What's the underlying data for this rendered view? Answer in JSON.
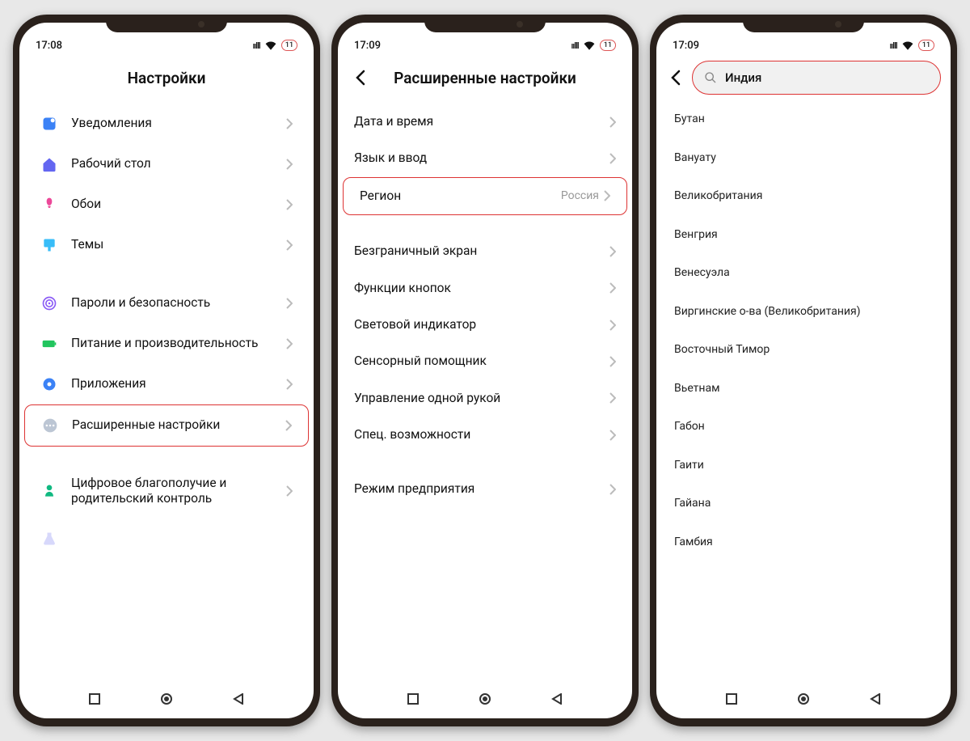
{
  "highlight_color": "#d33",
  "phone1": {
    "time": "17:08",
    "battery": "11",
    "title": "Настройки",
    "groups": [
      [
        {
          "icon": "notifications",
          "color": "#3b82f6",
          "label": "Уведомления"
        },
        {
          "icon": "home",
          "color": "#6366f1",
          "label": "Рабочий стол"
        },
        {
          "icon": "wallpaper",
          "color": "#ec4899",
          "label": "Обои"
        },
        {
          "icon": "themes",
          "color": "#38bdf8",
          "label": "Темы"
        }
      ],
      [
        {
          "icon": "security",
          "color": "#8b5cf6",
          "label": "Пароли и безопасность"
        },
        {
          "icon": "battery",
          "color": "#22c55e",
          "label": "Питание и производительность"
        },
        {
          "icon": "apps",
          "color": "#3b82f6",
          "label": "Приложения"
        },
        {
          "icon": "advanced",
          "color": "#94a3b8",
          "label": "Расширенные настройки",
          "highlight": true
        }
      ],
      [
        {
          "icon": "wellbeing",
          "color": "#10b981",
          "label": "Цифровое благополучие и родительский контроль"
        }
      ]
    ]
  },
  "phone2": {
    "time": "17:09",
    "battery": "11",
    "title": "Расширенные настройки",
    "groups": [
      [
        {
          "label": "Дата и время"
        },
        {
          "label": "Язык и ввод"
        },
        {
          "label": "Регион",
          "value": "Россия",
          "highlight": true
        }
      ],
      [
        {
          "label": "Безграничный экран"
        },
        {
          "label": "Функции кнопок"
        },
        {
          "label": "Световой индикатор"
        },
        {
          "label": "Сенсорный помощник"
        },
        {
          "label": "Управление одной рукой"
        },
        {
          "label": "Спец. возможности"
        }
      ],
      [
        {
          "label": "Режим предприятия"
        }
      ]
    ]
  },
  "phone3": {
    "time": "17:09",
    "battery": "11",
    "search": "Индия",
    "items": [
      "Бутан",
      "Вануату",
      "Великобритания",
      "Венгрия",
      "Венесуэла",
      "Виргинские о-ва (Великобритания)",
      "Восточный Тимор",
      "Вьетнам",
      "Габон",
      "Гаити",
      "Гайана",
      "Гамбия"
    ]
  }
}
